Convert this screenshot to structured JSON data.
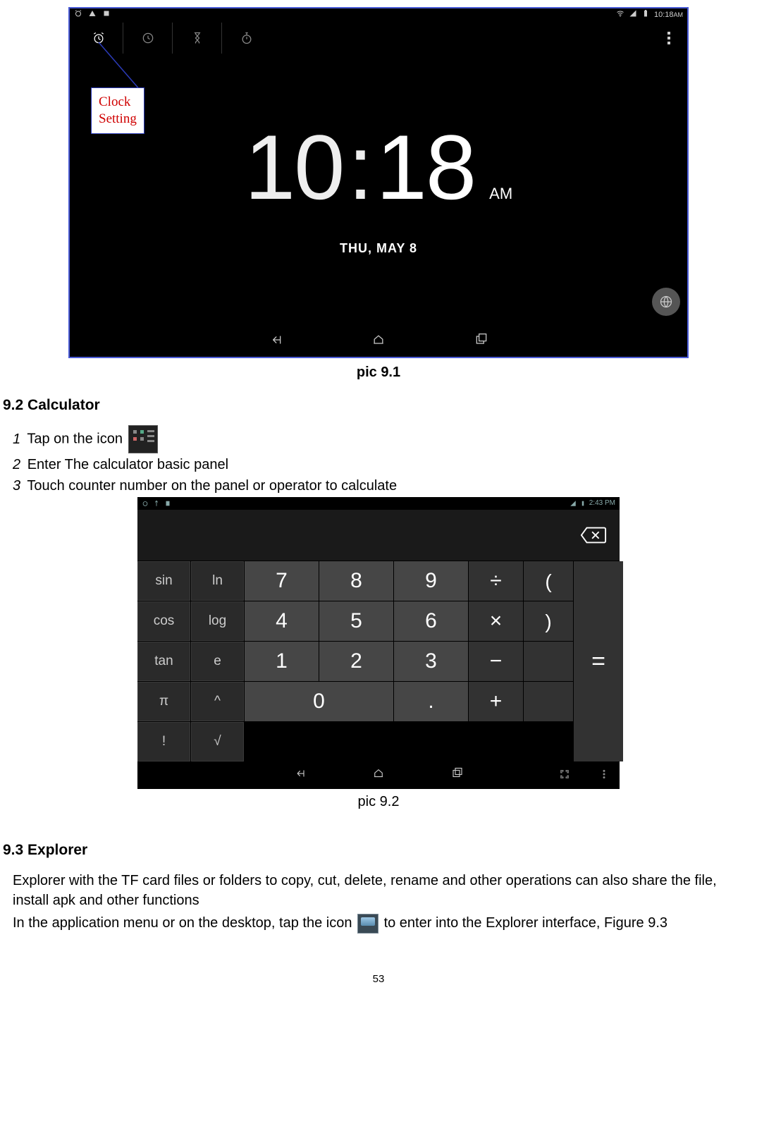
{
  "clock_shot": {
    "status_time": "10:18",
    "status_ampm": "AM",
    "time_hour": "10",
    "time_min": "18",
    "ampm": "AM",
    "date": "THU, MAY 8"
  },
  "callout": {
    "line1": "Clock",
    "line2": "Setting"
  },
  "caption1": "pic 9.1",
  "section92": "9.2 Calculator",
  "steps": {
    "s1_num": "1",
    "s1_text": "Tap on the icon",
    "s2_num": "2",
    "s2_text": "Enter The calculator basic panel",
    "s3_num": "3",
    "s3_text": "Touch counter number on the panel or operator to calculate"
  },
  "calc_shot": {
    "status_time": "2:43 PM",
    "keys": {
      "sin": "sin",
      "ln": "ln",
      "cos": "cos",
      "log": "log",
      "tan": "tan",
      "e": "e",
      "pi": "π",
      "pow": "^",
      "fact": "!",
      "sqrt": "√",
      "n7": "7",
      "n8": "8",
      "n9": "9",
      "n4": "4",
      "n5": "5",
      "n6": "6",
      "n1": "1",
      "n2": "2",
      "n3": "3",
      "n0": "0",
      "dot": ".",
      "div": "÷",
      "mul": "×",
      "sub": "−",
      "add": "+",
      "lp": "(",
      "rp": ")",
      "eq": "="
    }
  },
  "caption2": "pic 9.2",
  "section93": "9.3 Explorer",
  "explorer": {
    "p1": "Explorer with the TF card files or folders to copy, cut, delete, rename and other operations can also share the file, install apk and other functions",
    "p2a": "In the application menu or on the desktop, tap the icon",
    "p2b": "to enter into the Explorer interface, Figure 9.3"
  },
  "page_number": "53"
}
